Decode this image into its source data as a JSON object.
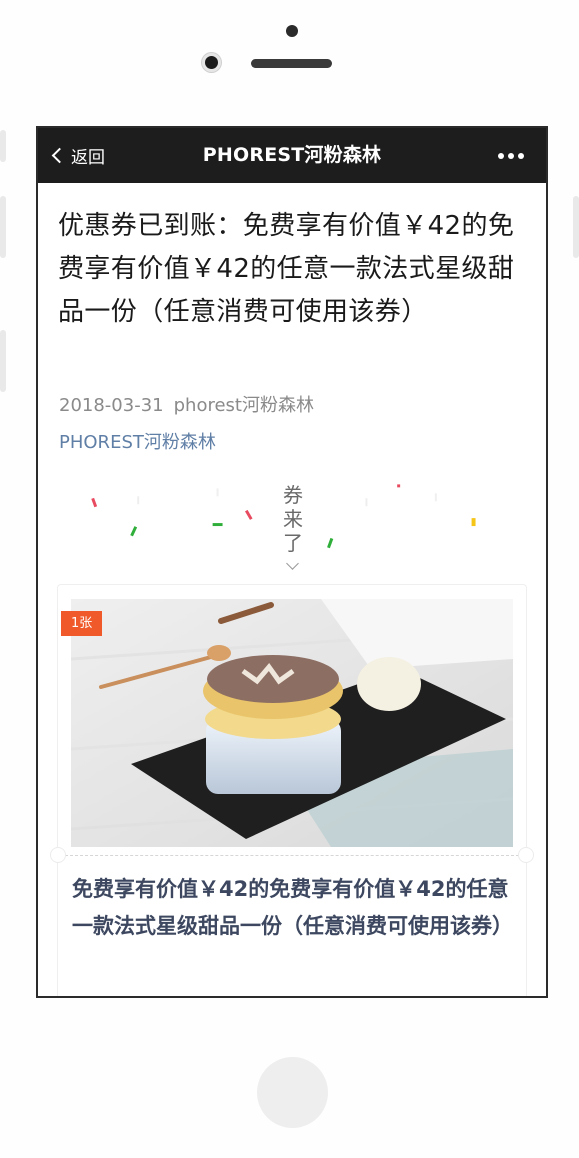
{
  "navbar": {
    "back_label": "返回",
    "title": "PHOREST河粉森林"
  },
  "article": {
    "title": "优惠券已到账：免费享有价值￥42的免费享有价值￥42的任意一款法式星级甜品一份（任意消费可使用该券）",
    "date": "2018-03-31",
    "author": "phorest河粉森林",
    "account_link": "PHOREST河粉森林"
  },
  "banner": {
    "text": "券来了"
  },
  "coupon_card": {
    "quantity_badge": "1张",
    "title": "免费享有价值￥42的免费享有价值￥42的任意一款法式星级甜品一份（任意消费可使用该券）"
  },
  "colors": {
    "navbar_bg": "#1d1d1d",
    "link": "#607fa6",
    "badge": "#f0592a",
    "card_title": "#3d4860"
  }
}
